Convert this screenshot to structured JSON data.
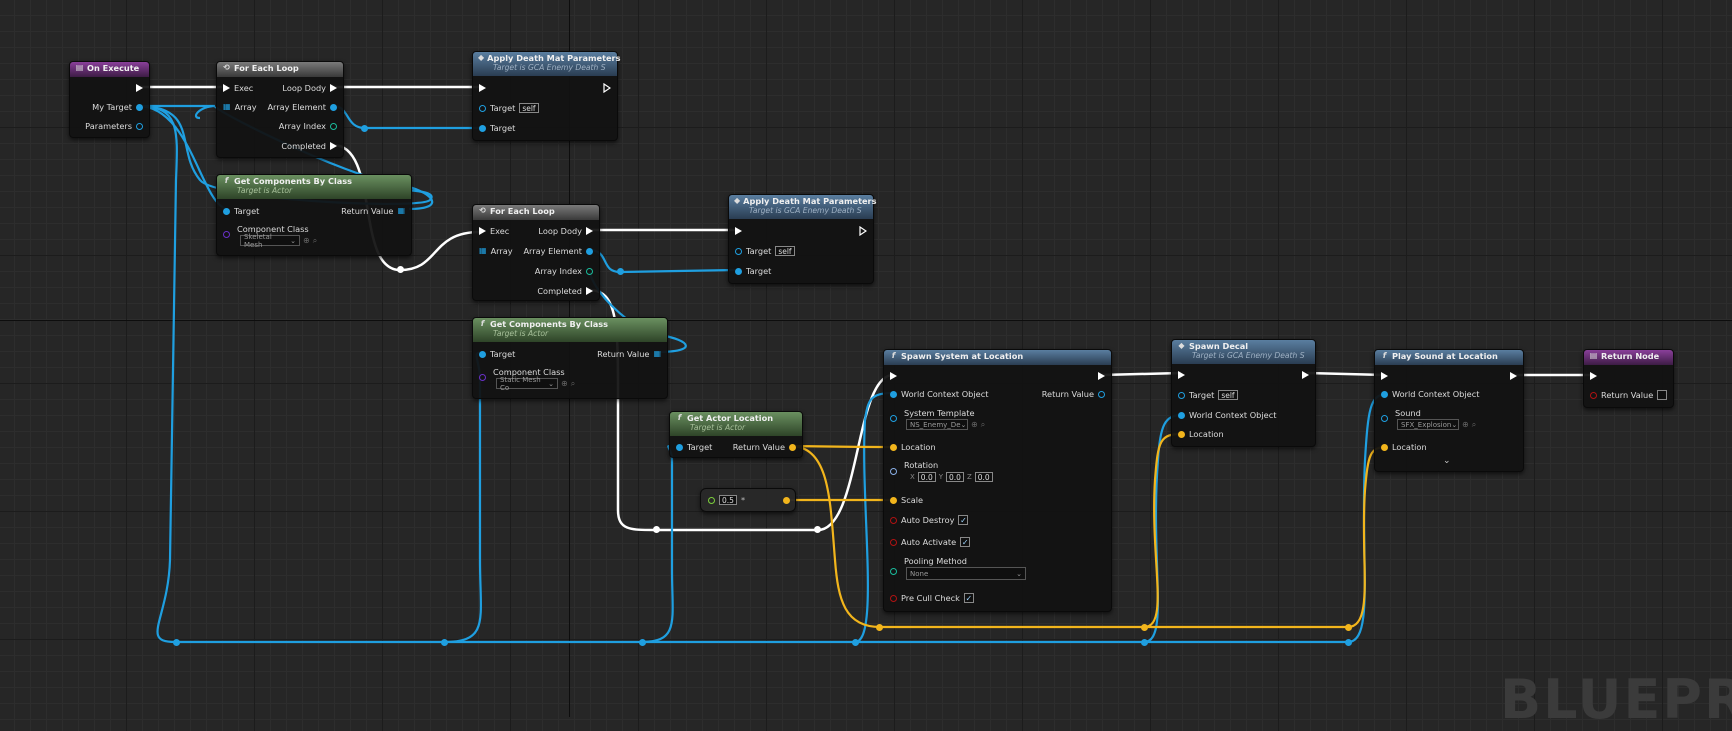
{
  "nodes": {
    "on_execute": {
      "title": "On Execute",
      "pins": {
        "my_target": "My Target",
        "parameters": "Parameters"
      }
    },
    "for_each_1": {
      "title": "For Each Loop",
      "pins": {
        "exec": "Exec",
        "array": "Array",
        "loop_body": "Loop Dody",
        "array_element": "Array Element",
        "array_index": "Array Index",
        "completed": "Completed"
      }
    },
    "apply_death_1": {
      "title": "Apply Death Mat Parameters",
      "subtitle": "Target is GCA Enemy Death S",
      "pins": {
        "target_self": "Target",
        "self": "self",
        "target": "Target"
      }
    },
    "get_comp_1": {
      "title": "Get Components By Class",
      "subtitle": "Target is Actor",
      "pins": {
        "target": "Target",
        "return_value": "Return Value",
        "component_class": "Component Class",
        "class_value": "Skeletal Mesh"
      }
    },
    "for_each_2": {
      "title": "For Each Loop",
      "pins": {
        "exec": "Exec",
        "array": "Array",
        "loop_body": "Loop Dody",
        "array_element": "Array Element",
        "array_index": "Array Index",
        "completed": "Completed"
      }
    },
    "apply_death_2": {
      "title": "Apply Death Mat Parameters",
      "subtitle": "Target is GCA Enemy Death S",
      "pins": {
        "target_self": "Target",
        "self": "self",
        "target": "Target"
      }
    },
    "get_comp_2": {
      "title": "Get Components By Class",
      "subtitle": "Target is Actor",
      "pins": {
        "target": "Target",
        "return_value": "Return Value",
        "component_class": "Component Class",
        "class_value": "Static Mesh Co"
      }
    },
    "get_actor_loc": {
      "title": "Get Actor Location",
      "subtitle": "Target is Actor",
      "pins": {
        "target": "Target",
        "return_value": "Return Value"
      }
    },
    "multiply": {
      "value": "0.5",
      "symbol": "*"
    },
    "spawn_system": {
      "title": "Spawn System at Location",
      "pins": {
        "world_context": "World Context Object",
        "return_value": "Return Value",
        "system_template": "System Template",
        "template_value": "NS_Enemy_De",
        "location": "Location",
        "rotation": "Rotation",
        "rx_label": "X",
        "rx": "0.0",
        "ry_label": "Y",
        "ry": "0.0",
        "rz_label": "Z",
        "rz": "0.0",
        "scale": "Scale",
        "auto_destroy": "Auto Destroy",
        "auto_activate": "Auto Activate",
        "pooling_method": "Pooling Method",
        "pooling_value": "None",
        "pre_cull": "Pre Cull Check"
      }
    },
    "spawn_decal": {
      "title": "Spawn Decal",
      "subtitle": "Target is GCA Enemy Death S",
      "pins": {
        "target": "Target",
        "self": "self",
        "world_context": "World Context Object",
        "location": "Location"
      }
    },
    "play_sound": {
      "title": "Play Sound at Location",
      "pins": {
        "world_context": "World Context Object",
        "sound": "Sound",
        "sound_value": "SFX_Explosion",
        "location": "Location"
      }
    },
    "return_node": {
      "title": "Return Node",
      "pins": {
        "return_value": "Return Value"
      }
    }
  },
  "watermark": "BLUEPR",
  "colors": {
    "exec": "#ffffff",
    "object": "#1f9fe0",
    "vector": "#f2b51c",
    "bool": "#b01212",
    "integer": "#1abc9c",
    "float": "#7cd03c",
    "class": "#6a30c8"
  }
}
